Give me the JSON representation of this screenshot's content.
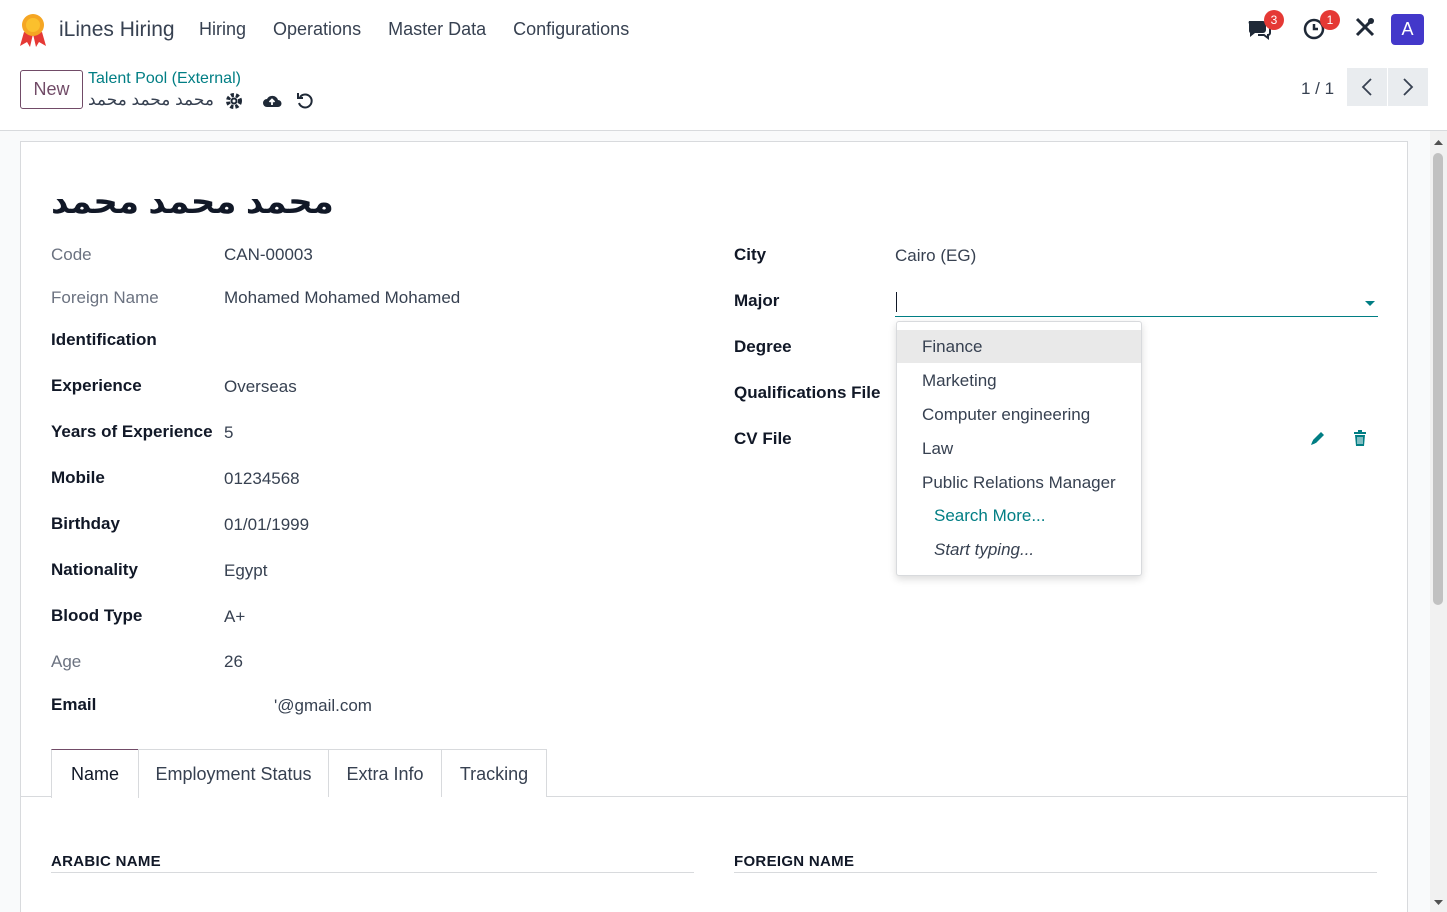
{
  "app": {
    "title": "iLines Hiring",
    "menu": [
      "Hiring",
      "Operations",
      "Master Data",
      "Configurations"
    ],
    "messages_count": "3",
    "activities_count": "1",
    "avatar_letter": "A"
  },
  "control": {
    "new_label": "New",
    "breadcrumb": "Talent Pool (External)",
    "record_name": "محمد محمد محمد",
    "pager": "1 / 1"
  },
  "form": {
    "title": "محمد محمد محمد",
    "left_fields": [
      {
        "label": "Code",
        "value": "CAN-00003"
      },
      {
        "label": "Foreign Name",
        "value": "Mohamed Mohamed Mohamed"
      },
      {
        "label": "Identification",
        "value": ""
      },
      {
        "label": "Experience",
        "value": "Overseas"
      },
      {
        "label": "Years of Experience",
        "value": "5"
      },
      {
        "label": "Mobile",
        "value": "01234568"
      },
      {
        "label": "Birthday",
        "value": "01/01/1999"
      },
      {
        "label": "Nationality",
        "value": "Egypt"
      },
      {
        "label": "Blood Type",
        "value": "A+"
      },
      {
        "label": "Age",
        "value": "26"
      },
      {
        "label": "Email",
        "value": "'@gmail.com"
      }
    ],
    "right_fields": [
      {
        "label": "City",
        "value": "Cairo (EG)"
      },
      {
        "label": "Major",
        "value": ""
      },
      {
        "label": "Degree",
        "value": ""
      },
      {
        "label": "Qualifications File",
        "value": ""
      },
      {
        "label": "CV File",
        "value": ""
      }
    ],
    "major_options": [
      "Finance",
      "Marketing",
      "Computer engineering",
      "Law",
      "Public Relations Manager"
    ],
    "search_more": "Search More...",
    "start_typing": "Start typing...",
    "tabs": [
      "Name",
      "Employment Status",
      "Extra Info",
      "Tracking"
    ],
    "sections": {
      "arabic": "ARABIC NAME",
      "foreign": "FOREIGN NAME"
    }
  },
  "colors": {
    "primary": "#714b67",
    "teal": "#017e84",
    "badge": "#e53935",
    "avatar": "#4338ca"
  }
}
